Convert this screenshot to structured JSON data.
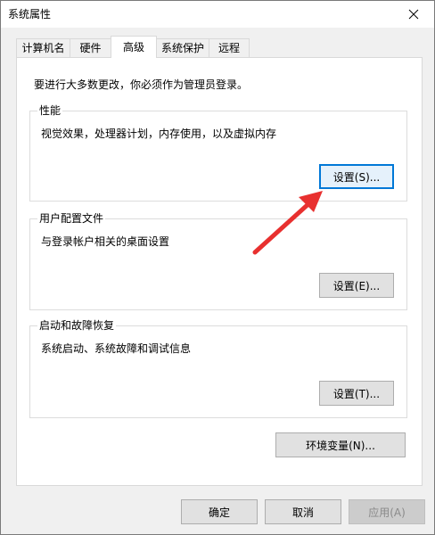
{
  "window": {
    "title": "系统属性"
  },
  "tabs": [
    {
      "label": "计算机名"
    },
    {
      "label": "硬件"
    },
    {
      "label": "高级"
    },
    {
      "label": "系统保护"
    },
    {
      "label": "远程"
    }
  ],
  "active_tab": "高级",
  "panel": {
    "notice": "要进行大多数更改，你必须作为管理员登录。",
    "groups": [
      {
        "title": "性能",
        "description": "视觉效果，处理器计划，内存使用，以及虚拟内存",
        "button": "设置(S)..."
      },
      {
        "title": "用户配置文件",
        "description": "与登录帐户相关的桌面设置",
        "button": "设置(E)..."
      },
      {
        "title": "启动和故障恢复",
        "description": "系统启动、系统故障和调试信息",
        "button": "设置(T)..."
      }
    ],
    "env_button": "环境变量(N)..."
  },
  "footer": {
    "ok": "确定",
    "cancel": "取消",
    "apply": "应用(A)"
  },
  "annotation": {
    "color": "#e8302f",
    "icon": "red-arrow"
  }
}
